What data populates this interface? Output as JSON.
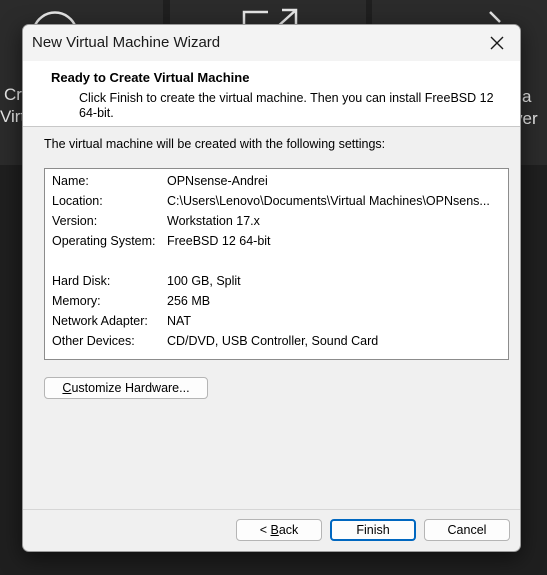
{
  "background": {
    "left_text_1": "Cr",
    "left_text_2": "Virt",
    "right_text_1": "a",
    "right_text_2": "ver"
  },
  "dialog": {
    "title": "New Virtual Machine Wizard",
    "header_title": "Ready to Create Virtual Machine",
    "header_subtitle": "Click Finish to create the virtual machine. Then you can install FreeBSD 12 64-bit.",
    "intro": "The virtual machine will be created with the following settings:",
    "settings": [
      {
        "key": "Name:",
        "value": "OPNsense-Andrei"
      },
      {
        "key": "Location:",
        "value": "C:\\Users\\Lenovo\\Documents\\Virtual Machines\\OPNsens..."
      },
      {
        "key": "Version:",
        "value": "Workstation 17.x"
      },
      {
        "key": "Operating System:",
        "value": "FreeBSD 12 64-bit"
      },
      {
        "key": "Hard Disk:",
        "value": "100 GB, Split"
      },
      {
        "key": "Memory:",
        "value": "256 MB"
      },
      {
        "key": "Network Adapter:",
        "value": "NAT"
      },
      {
        "key": "Other Devices:",
        "value": "CD/DVD, USB Controller, Sound Card"
      }
    ],
    "customize_prefix": "C",
    "customize_rest": "ustomize Hardware...",
    "back_prefix": "< ",
    "back_mnemonic": "B",
    "back_rest": "ack",
    "finish_label": "Finish",
    "cancel_label": "Cancel"
  },
  "colors": {
    "accent": "#0067c0",
    "dialog_bg": "#f0f0f0",
    "desktop_bg": "#1f1f1f"
  },
  "icons": [
    "close-icon",
    "disc-icon",
    "export-icon",
    "chevron-right-icon"
  ]
}
